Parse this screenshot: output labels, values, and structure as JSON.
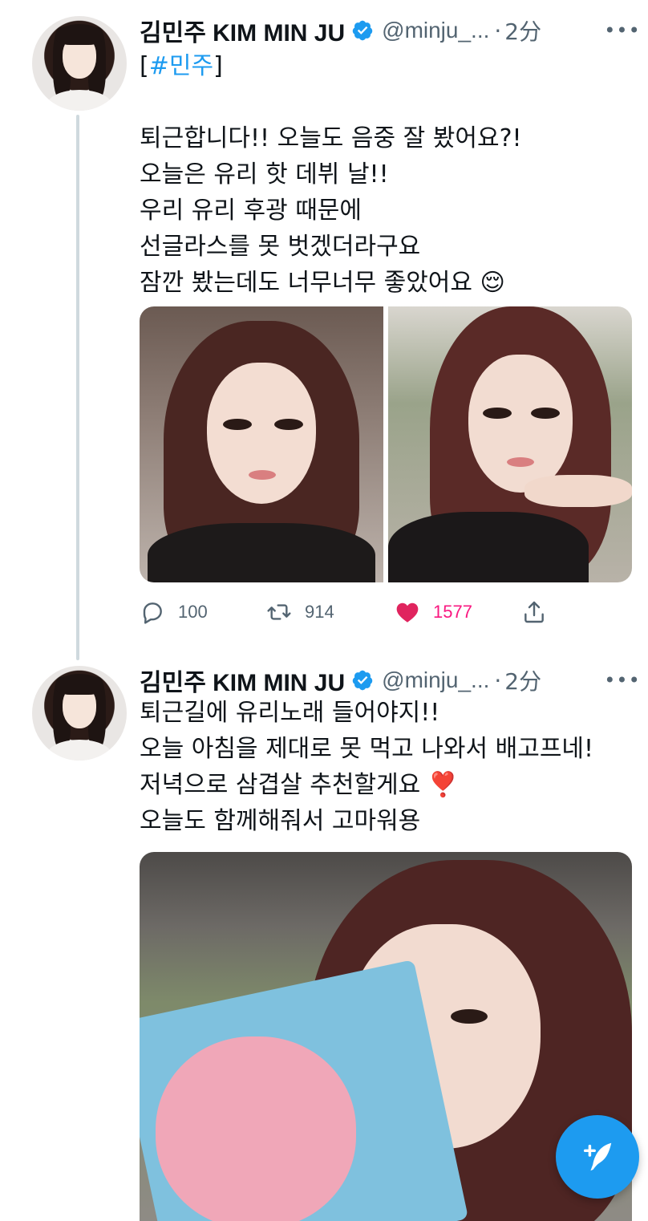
{
  "colors": {
    "accent": "#1d9bf0",
    "like": "#f91880",
    "muted": "#536471",
    "text": "#0f1419",
    "thread_line": "#cfd9de"
  },
  "tweets": [
    {
      "author_name": "김민주 KIM MIN JU",
      "handle": "@minju_...",
      "separator": "·",
      "time": "2分",
      "more_icon": "more-horizontal-icon",
      "verified_icon": "verified-badge-icon",
      "hashtag_open": "[",
      "hashtag": "#민주",
      "hashtag_close": "]",
      "lines": [
        "퇴근합니다!! 오늘도 음중 잘 봤어요?!",
        "오늘은 유리 핫 데뷔 날!!",
        "우리 유리 후광 때문에",
        "선글라스를 못 벗겠더라구요",
        "잠깐 봤는데도 너무너무 좋았어요 😌"
      ],
      "media": [
        {
          "icon": "selfie-photo"
        },
        {
          "icon": "selfie-photo-car"
        }
      ],
      "actions": {
        "reply": {
          "icon": "reply-icon",
          "count": "100"
        },
        "retweet": {
          "icon": "retweet-icon",
          "count": "914"
        },
        "like": {
          "icon": "heart-filled-icon",
          "count": "1577"
        },
        "share": {
          "icon": "share-icon"
        }
      }
    },
    {
      "author_name": "김민주 KIM MIN JU",
      "handle": "@minju_...",
      "separator": "·",
      "time": "2分",
      "more_icon": "more-horizontal-icon",
      "verified_icon": "verified-badge-icon",
      "lines": [
        "퇴근길에 유리노래 들어야지!!",
        "오늘 아침을 제대로 못 먹고 나와서 배고프네!",
        "저녁으로 삼겹살 추천할게요 ❣️",
        "오늘도 함께해줘서 고마워용"
      ],
      "media": [
        {
          "icon": "selfie-photo-with-box"
        }
      ]
    }
  ],
  "compose": {
    "icon": "compose-tweet-icon"
  }
}
